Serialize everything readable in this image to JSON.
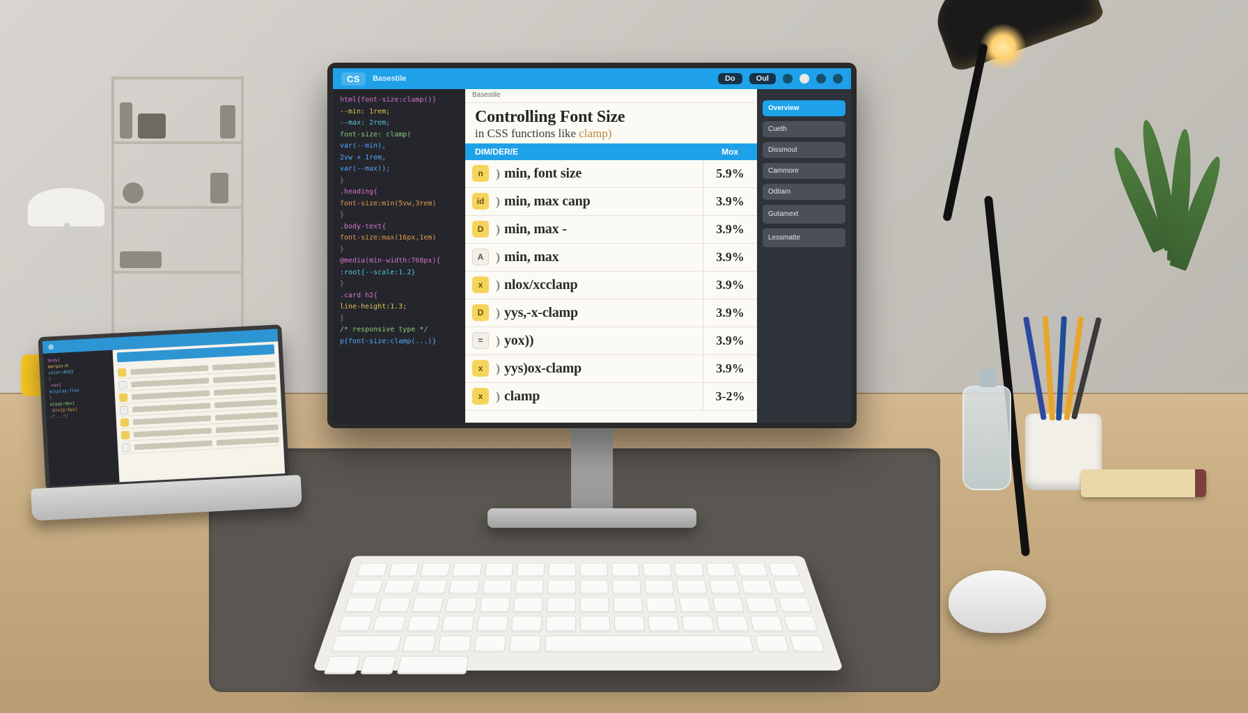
{
  "monitor": {
    "titlebar": {
      "app_tag": "CS",
      "filename": "Basestile",
      "buttons": [
        "Do",
        "Oul"
      ]
    },
    "code_lines": [
      {
        "cls": "c-mag",
        "text": "html{font-size:clamp()}"
      },
      {
        "cls": "c-yel",
        "text": "  --min: 1rem;"
      },
      {
        "cls": "c-cyan",
        "text": "  --max: 2rem;"
      },
      {
        "cls": "c-grn",
        "text": "  font-size: clamp("
      },
      {
        "cls": "c-blu",
        "text": "    var(--min),"
      },
      {
        "cls": "c-blu",
        "text": "    2vw + 1rem,"
      },
      {
        "cls": "c-blu",
        "text": "    var(--max));"
      },
      {
        "cls": "c-gray",
        "text": "}"
      },
      {
        "cls": "c-mag",
        "text": ".heading{"
      },
      {
        "cls": "c-ora",
        "text": "  font-size:min(5vw,3rem)"
      },
      {
        "cls": "c-gray",
        "text": "}"
      },
      {
        "cls": "c-mag",
        "text": ".body-text{"
      },
      {
        "cls": "c-ora",
        "text": "  font-size:max(16px,1em)"
      },
      {
        "cls": "c-gray",
        "text": "}"
      },
      {
        "cls": "c-mag",
        "text": "@media(min-width:768px){"
      },
      {
        "cls": "c-cyan",
        "text": "  :root{--scale:1.2}"
      },
      {
        "cls": "c-gray",
        "text": "}"
      },
      {
        "cls": "c-mag",
        "text": ".card h2{"
      },
      {
        "cls": "c-yel",
        "text": "  line-height:1.3;"
      },
      {
        "cls": "c-gray",
        "text": "}"
      },
      {
        "cls": "c-grn",
        "text": "/* responsive type */"
      },
      {
        "cls": "c-blu",
        "text": "p{font-size:clamp(...)}"
      }
    ],
    "doc": {
      "crumb": "Basestile",
      "title_line1": "Controlling Font Size",
      "title_line2_pre": "in CSS functions like ",
      "title_line2_fn": "clamp)",
      "table_header_a": "DIM/DER/E",
      "table_header_b": "Mox",
      "rows": [
        {
          "icon": "y",
          "icon_txt": "n",
          "paren": ")",
          "label": "min, font size",
          "val": "5.9%"
        },
        {
          "icon": "y",
          "icon_txt": "id",
          "paren": ")",
          "label": "min, max canp",
          "val": "3.9%"
        },
        {
          "icon": "y",
          "icon_txt": "D",
          "paren": ")",
          "label": "min, max -",
          "val": "3.9%"
        },
        {
          "icon": "w",
          "icon_txt": "A",
          "paren": ")",
          "label": "min, max",
          "val": "3.9%"
        },
        {
          "icon": "y",
          "icon_txt": "x",
          "paren": ")",
          "label": "nlox/xcclanp",
          "val": "3.9%"
        },
        {
          "icon": "y",
          "icon_txt": "D",
          "paren": ")",
          "label": "yys,-x-clamp",
          "val": "3.9%"
        },
        {
          "icon": "w",
          "icon_txt": "=",
          "paren": ")",
          "label": "yox))",
          "val": "3.9%"
        },
        {
          "icon": "y",
          "icon_txt": "x",
          "paren": ")",
          "label": "yys)ox-clamp",
          "val": "3.9%"
        },
        {
          "icon": "y",
          "icon_txt": "x",
          "paren": ")",
          "label": "clamp",
          "val": "3-2%"
        }
      ]
    },
    "side": {
      "header": "",
      "buttons": [
        {
          "label": "Overview",
          "primary": true
        },
        {
          "label": "Cueth",
          "primary": false
        },
        {
          "label": "Dissmout",
          "primary": false
        },
        {
          "label": "Cammore",
          "primary": false
        },
        {
          "label": "Odtiam",
          "primary": false
        },
        {
          "label": "Gutamext",
          "primary": false
        },
        {
          "label": "Lessmatte",
          "primary": false
        }
      ]
    }
  },
  "laptop": {
    "title": "",
    "code_lines": [
      {
        "cls": "c-mag",
        "text": "body{"
      },
      {
        "cls": "c-yel",
        "text": " margin:0"
      },
      {
        "cls": "c-cyan",
        "text": " color:#333"
      },
      {
        "cls": "c-gray",
        "text": "}"
      },
      {
        "cls": "c-mag",
        "text": ".nav{"
      },
      {
        "cls": "c-blu",
        "text": " display:flex"
      },
      {
        "cls": "c-gray",
        "text": "}"
      },
      {
        "cls": "c-grn",
        "text": "a{gap:8px}"
      },
      {
        "cls": "c-ora",
        "text": ".btn{p:6px}"
      },
      {
        "cls": "c-gray",
        "text": "/*...*/"
      }
    ],
    "rows": [
      {
        "icon": "y"
      },
      {
        "icon": "w"
      },
      {
        "icon": "y"
      },
      {
        "icon": "w"
      },
      {
        "icon": "y"
      },
      {
        "icon": "y"
      },
      {
        "icon": "w"
      }
    ]
  }
}
